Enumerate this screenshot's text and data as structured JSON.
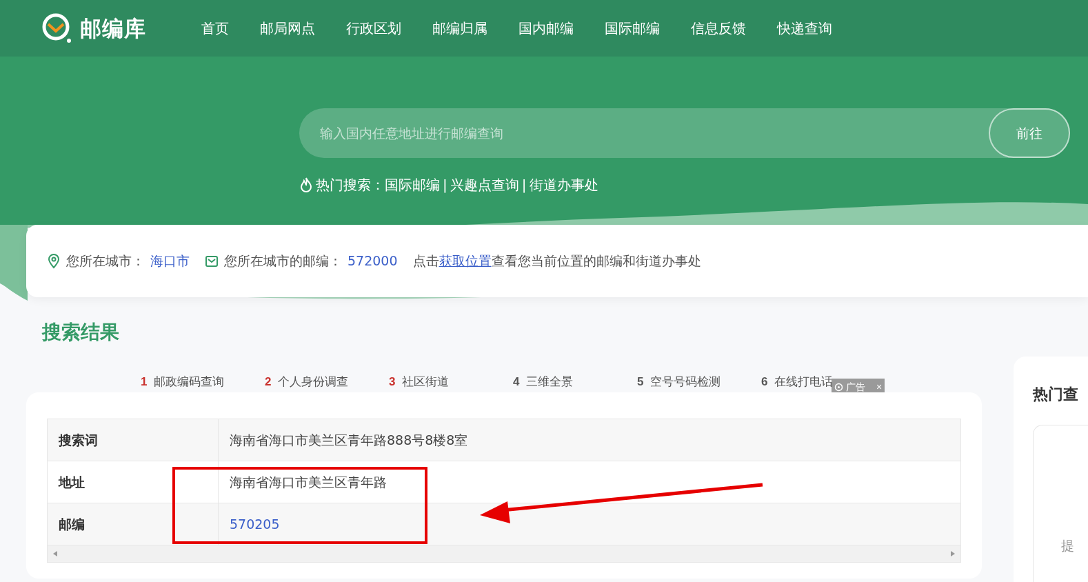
{
  "header": {
    "logo": "邮编库",
    "nav": [
      {
        "label": "首页"
      },
      {
        "label": "邮局网点"
      },
      {
        "label": "行政区划"
      },
      {
        "label": "邮编归属"
      },
      {
        "label": "国内邮编"
      },
      {
        "label": "国际邮编"
      },
      {
        "label": "信息反馈"
      },
      {
        "label": "快递查询"
      }
    ]
  },
  "search": {
    "placeholder": "输入国内任意地址进行邮编查询",
    "button": "前往"
  },
  "hot_search": {
    "label": "热门搜索：",
    "links": [
      "国际邮编",
      "兴趣点查询",
      "街道办事处"
    ],
    "separator": "|"
  },
  "location": {
    "city_label": "您所在城市：",
    "city": "海口市",
    "zip_label": "您所在城市的邮编：",
    "zip": "572000",
    "hint_before": "点击",
    "hint_link": "获取位置",
    "hint_after": "查看您当前位置的邮编和街道办事处"
  },
  "results_title": "搜索结果",
  "ad_links": [
    {
      "number": "1",
      "label": "邮政编码查询",
      "color": "#c9302c"
    },
    {
      "number": "2",
      "label": "个人身份调查",
      "color": "#c9302c"
    },
    {
      "number": "3",
      "label": "社区街道",
      "color": "#c9302c"
    },
    {
      "number": "4",
      "label": "三维全景",
      "color": "#555555"
    },
    {
      "number": "5",
      "label": "空号号码检测",
      "color": "#555555"
    },
    {
      "number": "6",
      "label": "在线打电话",
      "color": "#555555"
    }
  ],
  "ad_badge": {
    "label": "广告",
    "close": "×"
  },
  "table": {
    "rows": [
      {
        "label": "搜索词",
        "value": "海南省海口市美兰区青年路888号8楼8室",
        "kind": "text"
      },
      {
        "label": "地址",
        "value": "海南省海口市美兰区青年路",
        "kind": "text"
      },
      {
        "label": "邮编",
        "value": "570205",
        "kind": "link"
      }
    ]
  },
  "side_panel": {
    "title": "热门查",
    "text": "提"
  }
}
